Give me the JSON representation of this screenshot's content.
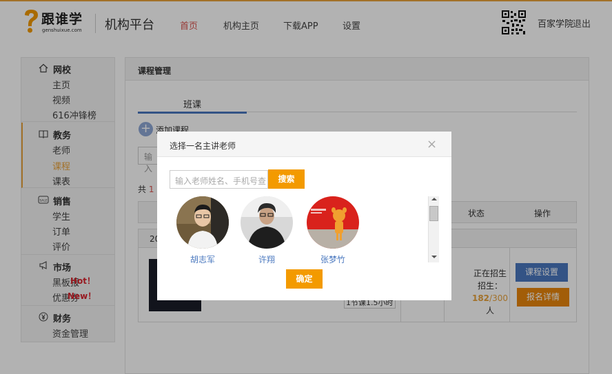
{
  "header": {
    "logo_text": "跟谁学",
    "logo_sub": "genshuixue.com",
    "platform_title": "机构平台",
    "nav": [
      {
        "label": "首页"
      },
      {
        "label": "机构主页"
      },
      {
        "label": "下载APP"
      },
      {
        "label": "设置"
      }
    ],
    "school_name": "百家学院",
    "logout": "退出"
  },
  "sidebar": {
    "groups": [
      {
        "title": "网校",
        "icon": "home-icon",
        "items": [
          "主页",
          "视频",
          "616冲锋榜"
        ]
      },
      {
        "title": "教务",
        "icon": "book-icon",
        "items": [
          "老师",
          "课程",
          "课表"
        ]
      },
      {
        "title": "销售",
        "icon": "sale-tag-icon",
        "items": [
          "学生",
          "订单",
          "评价"
        ]
      },
      {
        "title": "市场",
        "icon": "megaphone-icon",
        "items": [
          "黑板报",
          "优惠券"
        ]
      },
      {
        "title": "财务",
        "icon": "yen-icon",
        "items": [
          "资金管理"
        ]
      }
    ],
    "badges": {
      "hot": "Hot！",
      "new": "New！"
    }
  },
  "main": {
    "title": "课程管理",
    "tab": "班课",
    "add_course": "添加课程",
    "search_placeholder": "输入",
    "total_prefix": "共",
    "total_count": "1",
    "columns": {
      "status": "状态",
      "action": "操作"
    },
    "row": {
      "head": "20",
      "meta": "1节课1.5小时",
      "status": "正在招生",
      "enroll_label": "招生：",
      "enrolled": "182",
      "capacity": "300",
      "unit": "人",
      "btn_settings": "课程设置",
      "btn_details": "报名详情"
    }
  },
  "modal": {
    "title": "选择一名主讲老师",
    "search_placeholder": "输入老师姓名、手机号查",
    "search_button": "搜索",
    "teachers": [
      {
        "name": "胡志军"
      },
      {
        "name": "许翔"
      },
      {
        "name": "张梦竹"
      }
    ],
    "confirm": "确定"
  },
  "colors": {
    "accent": "#f39a00",
    "link_blue": "#4a78bf",
    "active_red": "#d9534f",
    "sidebar_highlight": "#e8a23c"
  }
}
